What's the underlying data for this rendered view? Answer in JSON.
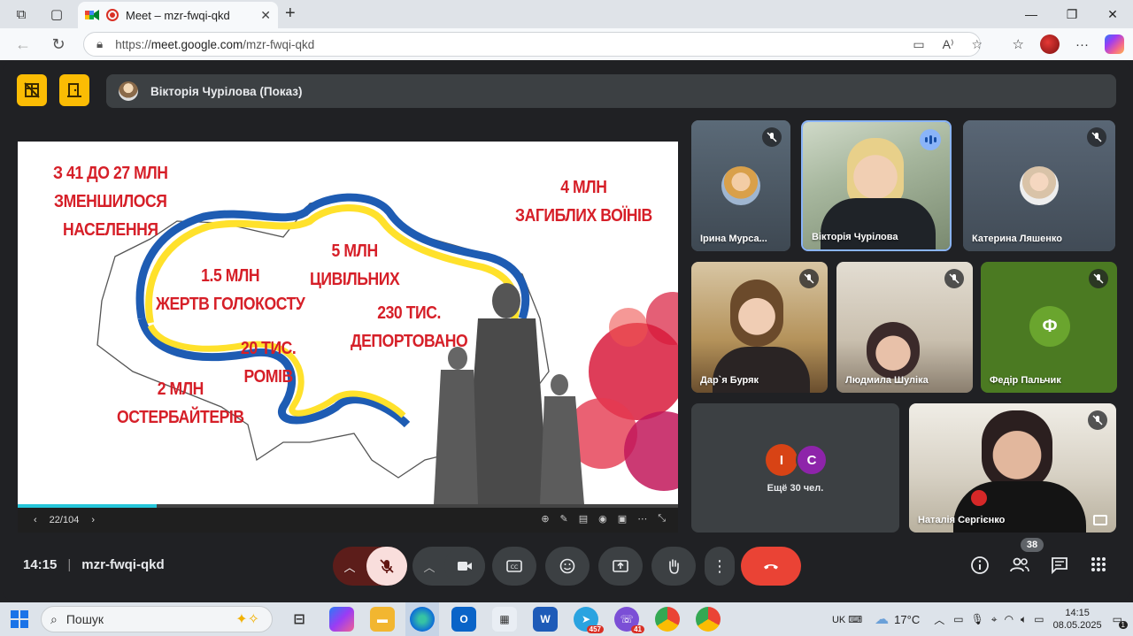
{
  "browser": {
    "tab_title": "Meet – mzr-fwqi-qkd",
    "url_prefix": "https://",
    "url_host": "meet.google.com",
    "url_path": "/mzr-fwqi-qkd"
  },
  "meet": {
    "presenter_label": "Вікторія Чурілова (Показ)",
    "time": "14:15",
    "meeting_code": "mzr-fwqi-qkd",
    "participants_count": "38",
    "more_people": "Ещё 30 чел.",
    "more_initials": [
      "I",
      "C"
    ]
  },
  "slide": {
    "texts": [
      "З 41 ДО 27 МЛН",
      "ЗМЕНШИЛОСЯ",
      "НАСЕЛЕННЯ",
      "4 МЛН",
      "ЗАГИБЛИХ ВОЇНІВ",
      "5 МЛН",
      "ЦИВІЛЬНИХ",
      "1.5 МЛН",
      "ЖЕРТВ ГОЛОКОСТУ",
      "230 ТИС.",
      "ДЕПОРТОВАНО",
      "20 ТИС.",
      "РОМІВ",
      "2 МЛН",
      "ОСТЕРБАЙТЕРІВ"
    ],
    "page": "22/104",
    "progress": 0.21
  },
  "tiles": [
    {
      "name": "Ірина Мурса..."
    },
    {
      "name": "Вікторія Чурілова"
    },
    {
      "name": "Катерина Ляшенко"
    },
    {
      "name": "Дар`я Буряк"
    },
    {
      "name": "Людмила Шуліка"
    },
    {
      "name": "Федір Пальчик",
      "initial": "Ф"
    },
    {
      "name": "Наталія Сергієнко"
    }
  ],
  "taskbar": {
    "search_placeholder": "Пошук",
    "weather": "17°C",
    "lang": "UK",
    "clock_time": "14:15",
    "clock_date": "08.05.2025",
    "telegram_badge": "457",
    "viber_badge": "41",
    "notif_count": "1"
  },
  "colors": {
    "accent_red": "#ea4335",
    "meet_bg": "#202124",
    "tile_bg": "#3c4043",
    "yellow": "#fbbc04",
    "green_avatar": "#5f8f2e"
  }
}
